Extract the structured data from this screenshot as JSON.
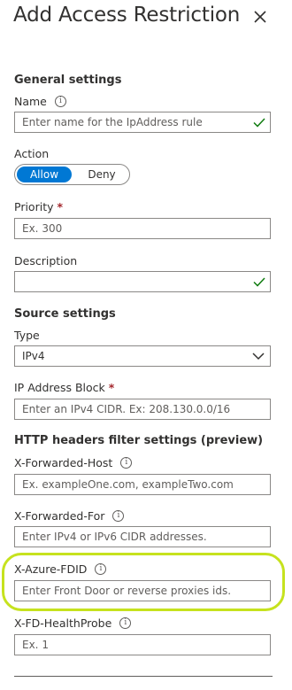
{
  "panel": {
    "title": "Add Access Restriction"
  },
  "general": {
    "heading": "General settings",
    "name_label": "Name",
    "name_placeholder": "Enter name for the IpAddress rule",
    "action_label": "Action",
    "action_options": [
      "Allow",
      "Deny"
    ],
    "action_selected": "Allow",
    "priority_label": "Priority",
    "priority_placeholder": "Ex. 300",
    "description_label": "Description",
    "description_value": ""
  },
  "source": {
    "heading": "Source settings",
    "type_label": "Type",
    "type_value": "IPv4",
    "ip_label": "IP Address Block",
    "ip_placeholder": "Enter an IPv4 CIDR. Ex: 208.130.0.0/16"
  },
  "http_headers": {
    "heading": "HTTP headers filter settings (preview)",
    "xfh_label": "X-Forwarded-Host",
    "xfh_placeholder": "Ex. exampleOne.com, exampleTwo.com",
    "xff_label": "X-Forwarded-For",
    "xff_placeholder": "Enter IPv4 or IPv6 CIDR addresses.",
    "fdid_label": "X-Azure-FDID",
    "fdid_placeholder": "Enter Front Door or reverse proxies ids.",
    "probe_label": "X-FD-HealthProbe",
    "probe_placeholder": "Ex. 1"
  },
  "required_marker": "*",
  "info_glyph": "i",
  "colors": {
    "accent": "#0078d4",
    "success_check": "#107c10",
    "highlight": "#c6e21e",
    "required": "#a4262c"
  }
}
